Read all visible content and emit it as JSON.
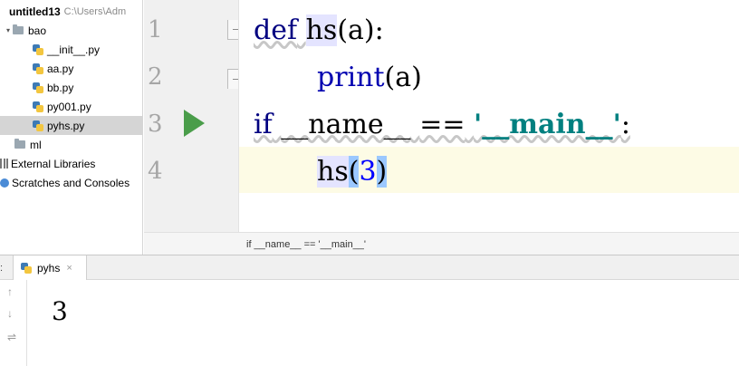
{
  "project": {
    "root_name": "untitled13",
    "root_path": "C:\\Users\\Adm",
    "items": [
      {
        "label": "bao",
        "type": "folder"
      },
      {
        "label": "__init__.py",
        "type": "file"
      },
      {
        "label": "aa.py",
        "type": "file"
      },
      {
        "label": "bb.py",
        "type": "file"
      },
      {
        "label": "py001.py",
        "type": "file"
      },
      {
        "label": "pyhs.py",
        "type": "file",
        "selected": true
      },
      {
        "label": "ml",
        "type": "folder"
      },
      {
        "label": "External Libraries",
        "type": "library"
      },
      {
        "label": "Scratches and Consoles",
        "type": "scratch"
      }
    ]
  },
  "editor": {
    "line_numbers": [
      "1",
      "2",
      "3",
      "4"
    ],
    "lines": [
      {
        "kw": "def",
        "fn": "hs",
        "rest": "(a):"
      },
      {
        "fn": "print",
        "rest": "(a)"
      },
      {
        "kw": "if",
        "name": "__name__",
        "op": "==",
        "str": "'__main__'",
        "colon": ":"
      },
      {
        "fn": "hs",
        "open": "(",
        "num": "3",
        "close": ")"
      }
    ],
    "breadcrumb": "if __name__ == '__main__'"
  },
  "run": {
    "tab_label": "pyhs",
    "close_glyph": "×",
    "side_icons": [
      "↑",
      "↓",
      "⇌"
    ],
    "output": "3"
  },
  "colors": {
    "keyword": "#000080",
    "string": "#008080",
    "number": "#0000ff",
    "run_icon": "#4a9d4a",
    "selected_row": "#d5d5d5",
    "current_line": "#fdfbe5"
  }
}
